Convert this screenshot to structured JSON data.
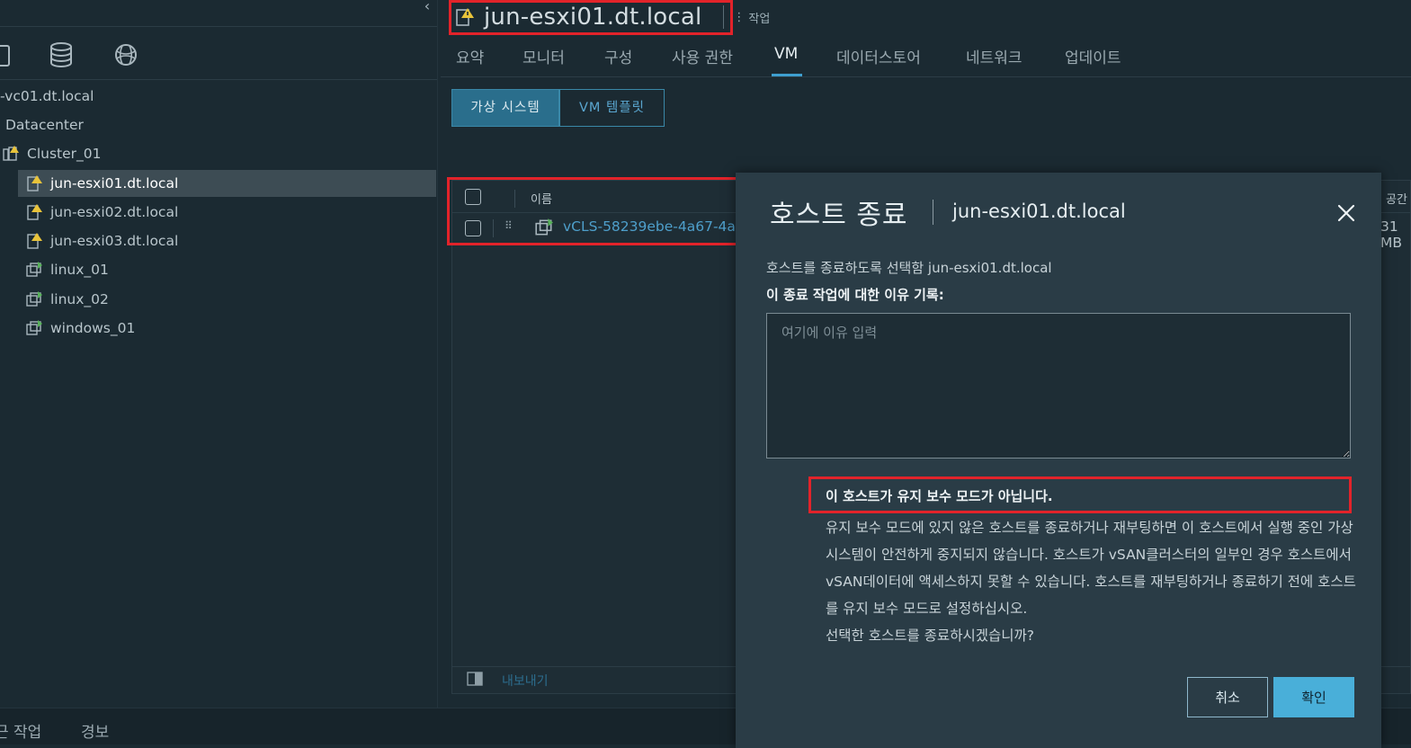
{
  "header": {
    "title": "jun-esxi01.dt.local",
    "actions_label": "작업"
  },
  "tabs": [
    {
      "label": "요약"
    },
    {
      "label": "모니터"
    },
    {
      "label": "구성"
    },
    {
      "label": "사용 권한"
    },
    {
      "label": "VM"
    },
    {
      "label": "데이터스토어"
    },
    {
      "label": "네트워크"
    },
    {
      "label": "업데이트"
    }
  ],
  "active_tab": "VM",
  "segments": {
    "vm_label": "가상 시스템",
    "template_label": "VM 템플릿"
  },
  "tree": [
    {
      "label": "-vc01.dt.local"
    },
    {
      "label": "Datacenter"
    },
    {
      "label": "Cluster_01"
    },
    {
      "label": "jun-esxi01.dt.local"
    },
    {
      "label": "jun-esxi02.dt.local"
    },
    {
      "label": "jun-esxi03.dt.local"
    },
    {
      "label": "linux_01"
    },
    {
      "label": "linux_02"
    },
    {
      "label": "windows_01"
    }
  ],
  "grid": {
    "col_name": "이름",
    "col_space": "공간",
    "row_name": "vCLS-58239ebe-4a67-4a",
    "row_size": "31 MB",
    "export_label": "내보내기"
  },
  "bottom_tabs": [
    "근 작업",
    "경보"
  ],
  "modal": {
    "title": "호스트 종료",
    "subject": "jun-esxi01.dt.local",
    "description": "호스트를 종료하도록 선택함 jun-esxi01.dt.local",
    "reason_label": "이 종료 작업에 대한 이유 기록:",
    "reason_placeholder": "여기에 이유 입력",
    "reason_value": "",
    "warning_heading": "이 호스트가 유지 보수 모드가 아닙니다.",
    "warning_body": "유지 보수 모드에 있지 않은 호스트를 종료하거나 재부팅하면 이 호스트에서 실행 중인 가상 시스템이 안전하게 중지되지 않습니다. 호스트가 vSAN클러스터의 일부인 경우 호스트에서 vSAN데이터에 액세스하지 못할 수 있습니다. 호스트를 재부팅하거나 종료하기 전에 호스트를 유지 보수 모드로 설정하십시오.",
    "confirm_question": "선택한 호스트를 종료하시겠습니까?",
    "cancel_label": "취소",
    "ok_label": "확인"
  },
  "colors": {
    "accent": "#49afd9",
    "highlight": "#e2232a",
    "warning": "#e8c33a"
  }
}
